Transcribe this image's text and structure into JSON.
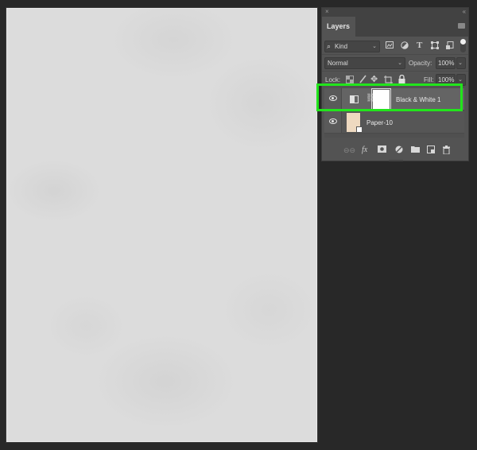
{
  "canvas": {
    "document": "Paper-10"
  },
  "layers_panel": {
    "close_glyph": "×",
    "collapse_glyph": "‹‹",
    "tab_label": "Layers",
    "panel_menu_icon": "panel-menu-icon",
    "filter": {
      "search_icon": "⌕",
      "kind_value": "Kind",
      "filter_icons": [
        "image-filter-icon",
        "adjustment-filter-icon",
        "type-filter-icon",
        "shape-filter-icon",
        "smart-object-filter-icon"
      ],
      "toggle": "filter-toggle"
    },
    "blend": {
      "mode": "Normal",
      "opacity_label": "Opacity:",
      "opacity_value": "100%"
    },
    "lock": {
      "label": "Lock:",
      "icons": [
        "lock-transparent-pixels-icon",
        "lock-image-pixels-icon",
        "lock-position-icon",
        "lock-artboard-icon",
        "lock-all-icon"
      ],
      "fill_label": "Fill:",
      "fill_value": "100%"
    },
    "layers": [
      {
        "name": "Black & White 1",
        "type": "adjustment",
        "visible": true,
        "selected": true
      },
      {
        "name": "Paper-10",
        "type": "smart-object",
        "visible": true,
        "selected": false
      }
    ],
    "footer_icons": [
      "link-layers-icon",
      "fx-icon",
      "add-mask-icon",
      "new-adjustment-icon",
      "new-group-icon",
      "new-layer-icon",
      "delete-icon"
    ],
    "highlight_color": "#22e51c"
  }
}
